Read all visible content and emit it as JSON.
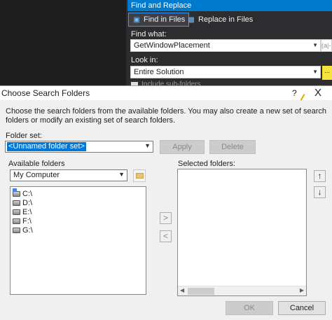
{
  "find_replace": {
    "title": "Find and Replace",
    "tabs": [
      {
        "label": "Find in Files",
        "active": true
      },
      {
        "label": "Replace in Files",
        "active": false
      }
    ],
    "find_what_label": "Find what:",
    "find_what_value": "GetWindowPlacement",
    "find_side_text": "(a|-",
    "look_in_label": "Look in:",
    "look_in_value": "Entire Solution",
    "browse_label": "...",
    "include_subfolders_label": "Include sub-folders"
  },
  "dialog": {
    "title": "Choose Search Folders",
    "help_label": "?",
    "close_label": "X",
    "instructions": "Choose the search folders from the available folders. You may also create a new set of search folders or modify an existing set of search folders.",
    "folder_set_label": "Folder set:",
    "folder_set_value": "<Unnamed folder set>",
    "apply_label": "Apply",
    "delete_label": "Delete",
    "available_label": "Available folders",
    "available_combo_value": "My Computer",
    "drives": [
      "C:\\",
      "D:\\",
      "E:\\",
      "F:\\",
      "G:\\"
    ],
    "selected_label": "Selected folders:",
    "add_arrow": ">",
    "remove_arrow": "<",
    "up_arrow": "↑",
    "down_arrow": "↓",
    "ok_label": "OK",
    "cancel_label": "Cancel"
  },
  "colors": {
    "vs_blue": "#007acc",
    "panel_dark": "#2d2d30",
    "selection": "#0078d7",
    "highlight_yellow": "#f5e23a"
  }
}
